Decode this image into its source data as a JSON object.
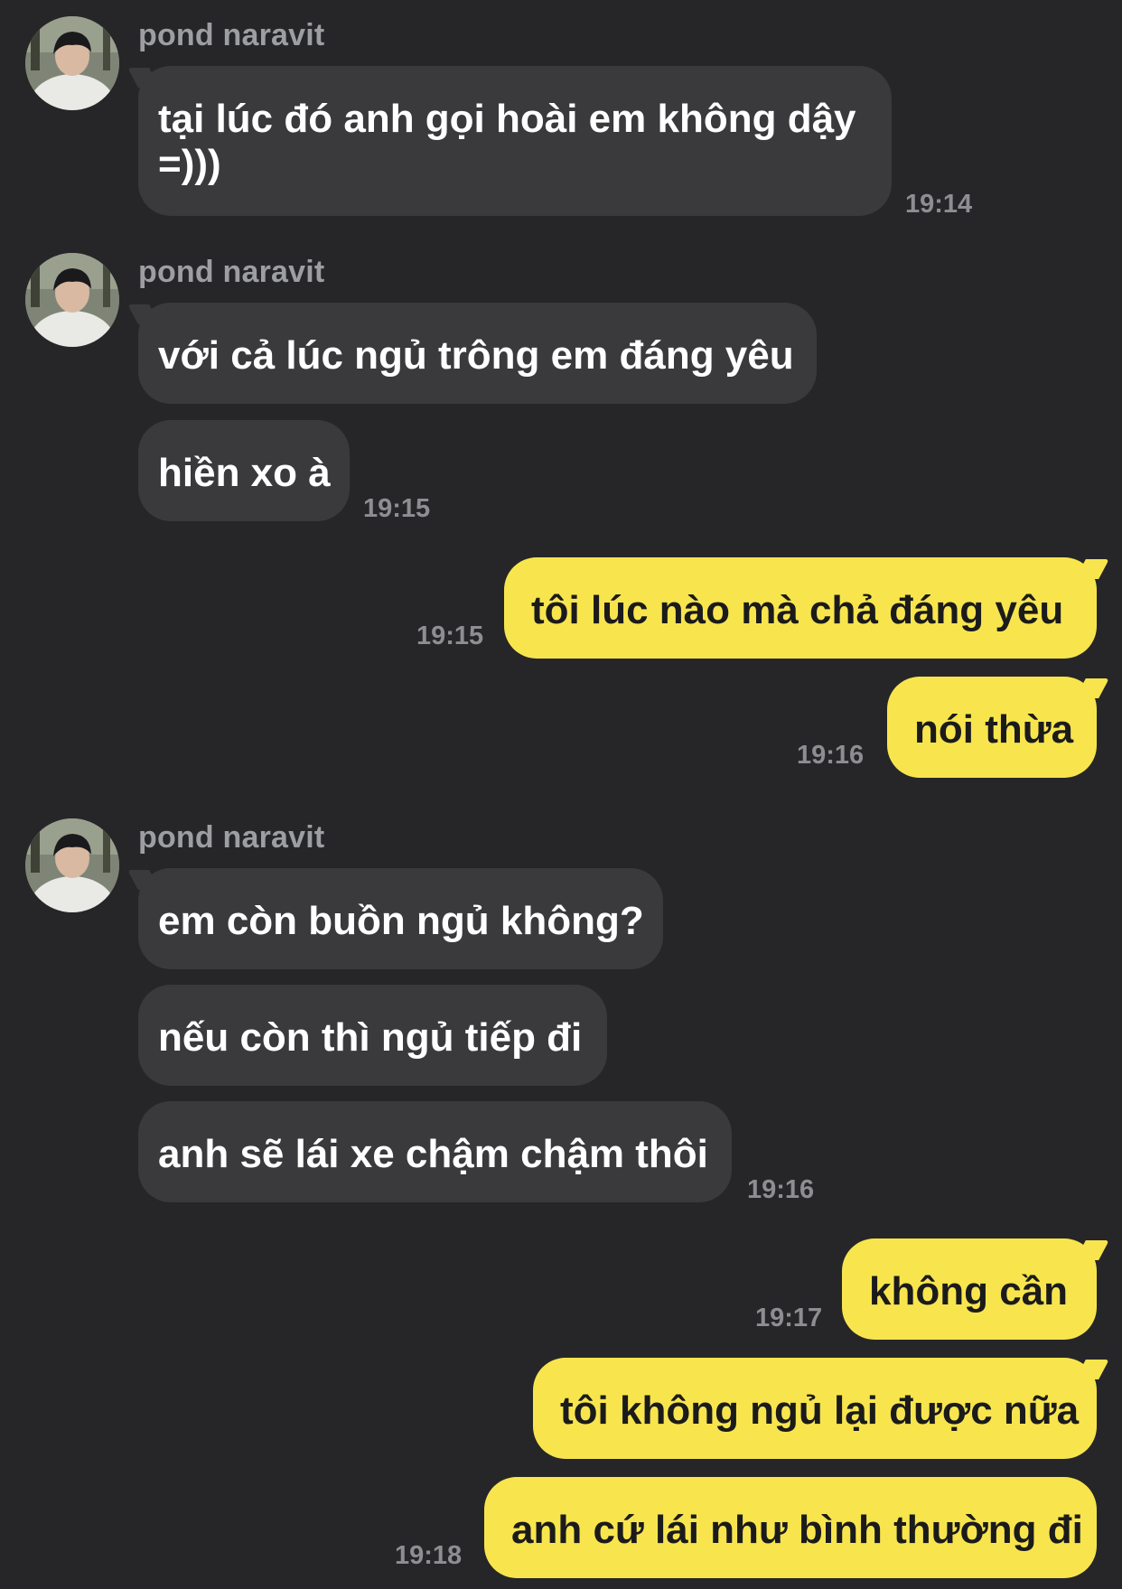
{
  "chat": {
    "contact_name": "pond naravit",
    "groups": [
      {
        "sender": "pond naravit",
        "messages": [
          "tại lúc đó anh gọi hoài em không dậy",
          "=)))"
        ],
        "time": "19:14"
      },
      {
        "sender": "pond naravit",
        "messages": [
          "với cả lúc ngủ trông em đáng yêu",
          "hiền xo à"
        ],
        "time": "19:15"
      },
      {
        "sender": "me",
        "messages": [
          "tôi lúc nào mà chả đáng yêu"
        ],
        "time": "19:15"
      },
      {
        "sender": "me",
        "messages": [
          "nói thừa"
        ],
        "time": "19:16"
      },
      {
        "sender": "pond naravit",
        "messages": [
          "em còn buồn ngủ không?",
          "nếu còn thì ngủ tiếp đi",
          "anh sẽ lái xe chậm chậm thôi"
        ],
        "time": "19:16"
      },
      {
        "sender": "me",
        "messages": [
          "không cần"
        ],
        "time": "19:17"
      },
      {
        "sender": "me",
        "messages": [
          "tôi không ngủ lại được nữa",
          "anh cứ lái như bình thường đi"
        ],
        "time": "19:18"
      }
    ]
  },
  "colors": {
    "background": "#262628",
    "incoming_bubble": "#3a3a3d",
    "outgoing_bubble": "#f8e54e",
    "sender_name": "#9d9ea2",
    "timestamp": "#8e8e92"
  },
  "icons": {
    "avatar": "profile-photo-avatar"
  }
}
